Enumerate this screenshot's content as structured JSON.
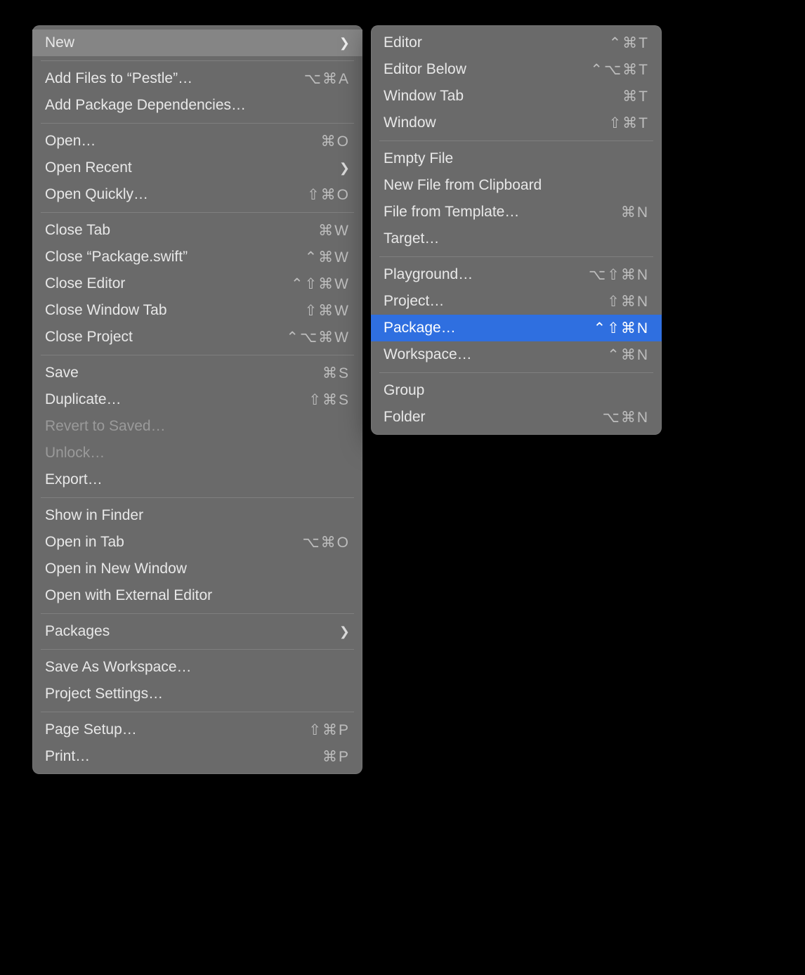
{
  "mainMenu": {
    "new": {
      "label": "New"
    },
    "addFiles": {
      "label": "Add Files to “Pestle”…",
      "shortcut": "⌥⌘A"
    },
    "addPkgDeps": {
      "label": "Add Package Dependencies…"
    },
    "open": {
      "label": "Open…",
      "shortcut": "⌘O"
    },
    "openRecent": {
      "label": "Open Recent"
    },
    "openQuickly": {
      "label": "Open Quickly…",
      "shortcut": "⇧⌘O"
    },
    "closeTab": {
      "label": "Close Tab",
      "shortcut": "⌘W"
    },
    "closeFile": {
      "label": "Close “Package.swift”",
      "shortcut": "⌃⌘W"
    },
    "closeEditor": {
      "label": "Close Editor",
      "shortcut": "⌃⇧⌘W"
    },
    "closeWindowTab": {
      "label": "Close Window Tab",
      "shortcut": "⇧⌘W"
    },
    "closeProject": {
      "label": "Close Project",
      "shortcut": "⌃⌥⌘W"
    },
    "save": {
      "label": "Save",
      "shortcut": "⌘S"
    },
    "duplicate": {
      "label": "Duplicate…",
      "shortcut": "⇧⌘S"
    },
    "revert": {
      "label": "Revert to Saved…"
    },
    "unlock": {
      "label": "Unlock…"
    },
    "export": {
      "label": "Export…"
    },
    "showInFinder": {
      "label": "Show in Finder"
    },
    "openInTab": {
      "label": "Open in Tab",
      "shortcut": "⌥⌘O"
    },
    "openInNewWindow": {
      "label": "Open in New Window"
    },
    "openExternal": {
      "label": "Open with External Editor"
    },
    "packages": {
      "label": "Packages"
    },
    "saveAsWorkspace": {
      "label": "Save As Workspace…"
    },
    "projectSettings": {
      "label": "Project Settings…"
    },
    "pageSetup": {
      "label": "Page Setup…",
      "shortcut": "⇧⌘P"
    },
    "print": {
      "label": "Print…",
      "shortcut": "⌘P"
    }
  },
  "subMenu": {
    "editor": {
      "label": "Editor",
      "shortcut": "⌃⌘T"
    },
    "editorBelow": {
      "label": "Editor Below",
      "shortcut": "⌃⌥⌘T"
    },
    "windowTab": {
      "label": "Window Tab",
      "shortcut": "⌘T"
    },
    "window": {
      "label": "Window",
      "shortcut": "⇧⌘T"
    },
    "emptyFile": {
      "label": "Empty File"
    },
    "newFileClipboard": {
      "label": "New File from Clipboard"
    },
    "fileFromTemplate": {
      "label": "File from Template…",
      "shortcut": "⌘N"
    },
    "target": {
      "label": "Target…"
    },
    "playground": {
      "label": "Playground…",
      "shortcut": "⌥⇧⌘N"
    },
    "project": {
      "label": "Project…",
      "shortcut": "⇧⌘N"
    },
    "package": {
      "label": "Package…",
      "shortcut": "⌃⇧⌘N"
    },
    "workspace": {
      "label": "Workspace…",
      "shortcut": "⌃⌘N"
    },
    "group": {
      "label": "Group"
    },
    "folder": {
      "label": "Folder",
      "shortcut": "⌥⌘N"
    }
  }
}
